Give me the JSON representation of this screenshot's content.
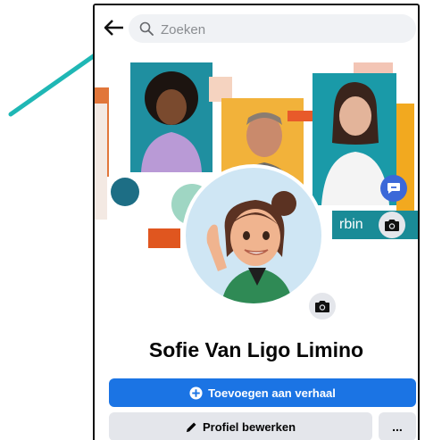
{
  "search": {
    "placeholder": "Zoeken"
  },
  "profile": {
    "name": "Sofie Van Ligo Limino",
    "add_story_label": "Toevoegen aan verhaal",
    "edit_profile_label": "Profiel bewerken",
    "more_label": "..."
  },
  "cover": {
    "banner_text": "rbin"
  },
  "colors": {
    "primary": "#1b74e4",
    "secondary": "#e4e6eb",
    "arrow": "#1fb7b5",
    "teal_block": "#1a8b97"
  },
  "icons": [
    "back-arrow-icon",
    "search-icon",
    "camera-icon",
    "plus-circle-icon",
    "pencil-icon",
    "chat-icon"
  ]
}
